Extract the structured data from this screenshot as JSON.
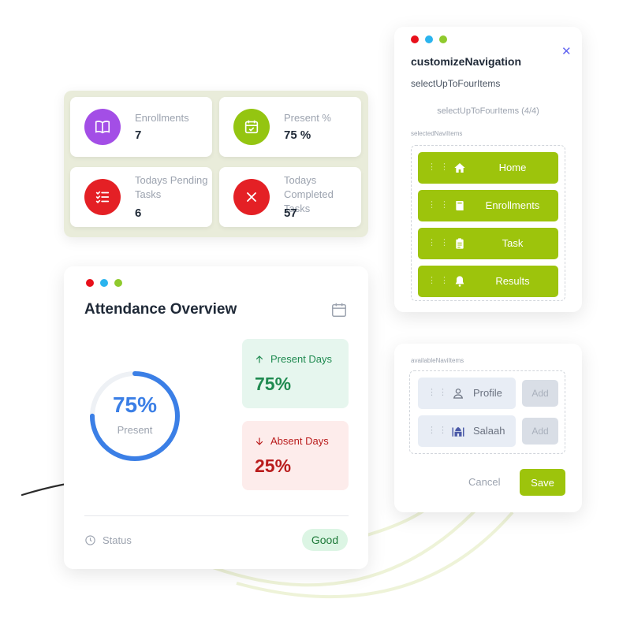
{
  "window_dots": {
    "red": "#e8101b",
    "blue": "#2bb4ee",
    "green": "#8fca2d"
  },
  "stats": [
    {
      "label": "Enrollments",
      "value": "7",
      "icon": "book-icon",
      "color": "#a34ee6"
    },
    {
      "label": "Present %",
      "value": "75 %",
      "icon": "calendar-check-icon",
      "color": "#94c511"
    },
    {
      "label": "Todays Pending Tasks",
      "value": "6",
      "icon": "task-list-icon",
      "color": "#e42025"
    },
    {
      "label": "Todays Completed Tasks",
      "value": "57",
      "icon": "close-circle-icon",
      "color": "#e42025"
    }
  ],
  "attendance": {
    "title": "Attendance Overview",
    "ring": {
      "percent": "75%",
      "label": "Present",
      "fraction": 0.75,
      "color": "#3b7fe6"
    },
    "present": {
      "label": "Present Days",
      "value": "75%",
      "color": "#1f8a50"
    },
    "absent": {
      "label": "Absent Days",
      "value": "25%",
      "color": "#b91c1c"
    },
    "status_label": "Status",
    "status_value": "Good"
  },
  "customize": {
    "title": "customizeNavigation",
    "subtitle": "selectUpToFourItems",
    "count": "selectUpToFourItems (4/4)",
    "selected_label": "selectedNaviItems",
    "items": [
      {
        "label": "Home",
        "icon": "home-icon"
      },
      {
        "label": "Enrollments",
        "icon": "book-icon"
      },
      {
        "label": "Task",
        "icon": "clipboard-icon"
      },
      {
        "label": "Results",
        "icon": "bell-icon"
      }
    ],
    "accent": "#9dc40c"
  },
  "available": {
    "label": "availableNaviItems",
    "items": [
      {
        "label": "Profile",
        "icon": "user-icon",
        "add_label": "Add"
      },
      {
        "label": "Salaah",
        "icon": "mosque-icon",
        "add_label": "Add"
      }
    ],
    "cancel_label": "Cancel",
    "save_label": "Save"
  }
}
